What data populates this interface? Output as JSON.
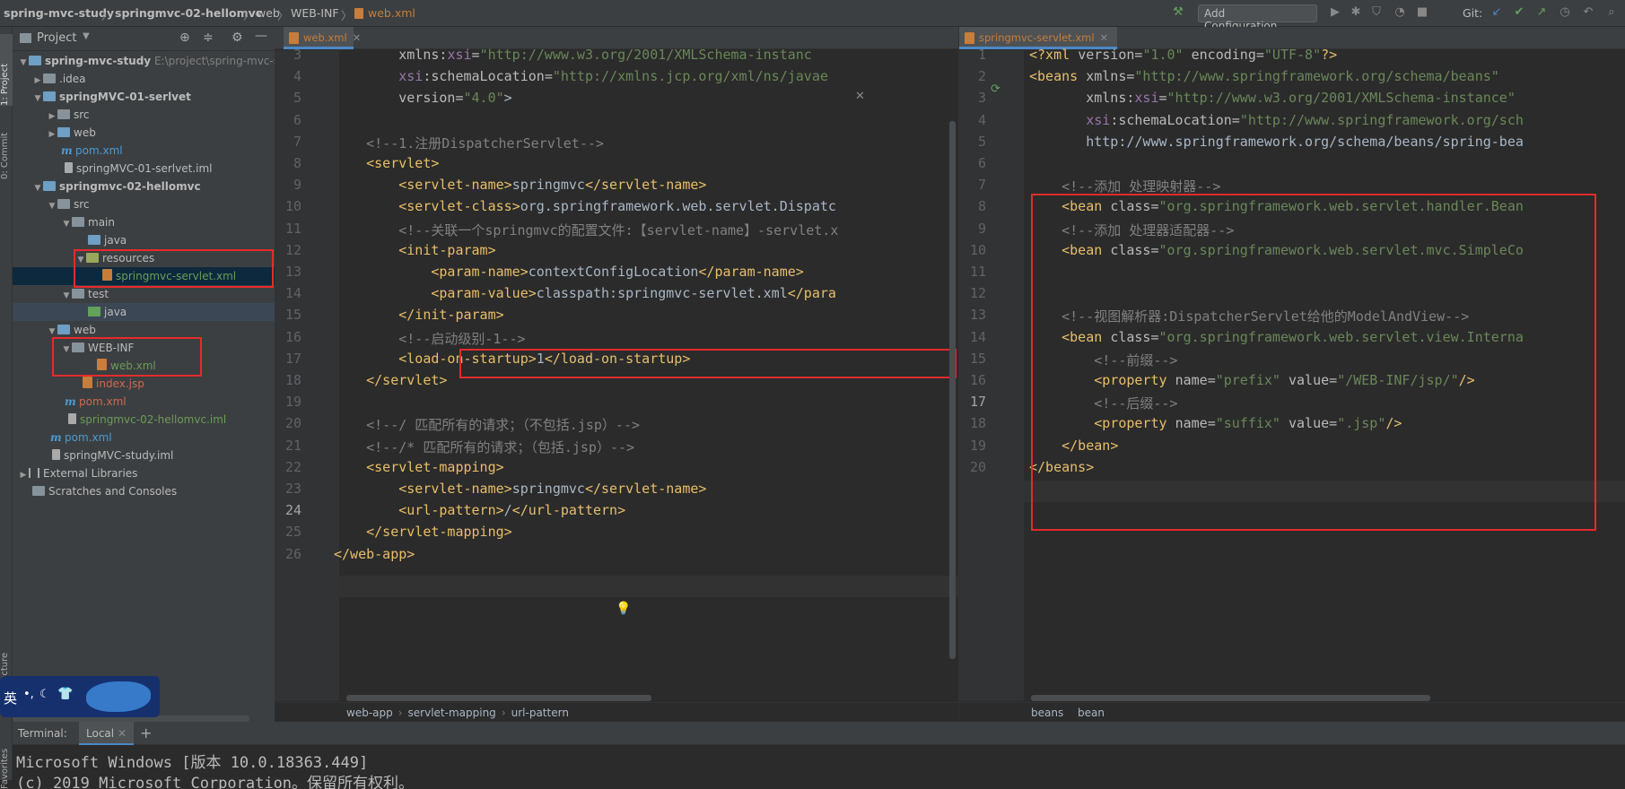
{
  "topbar": {
    "breadcrumbs": [
      "spring-mvc-study",
      "springmvc-02-hellomvc",
      "web",
      "WEB-INF",
      "web.xml"
    ],
    "add_configuration": "Add Configuration...",
    "git_label": "Git:"
  },
  "left_strip": {
    "project_label": "1: Project",
    "commit_label": "0: Commit",
    "structure_label": "ucture",
    "favorites_label": "Favorites"
  },
  "project_panel": {
    "title": "Project",
    "items": [
      {
        "label": "spring-mvc-study",
        "path": "E:\\project\\spring-mvc-s"
      },
      {
        "label": ".idea"
      },
      {
        "label": "springMVC-01-serlvet"
      },
      {
        "label": "src"
      },
      {
        "label": "web"
      },
      {
        "label": "pom.xml"
      },
      {
        "label": "springMVC-01-serlvet.iml"
      },
      {
        "label": "springmvc-02-hellomvc"
      },
      {
        "label": "src"
      },
      {
        "label": "main"
      },
      {
        "label": "java"
      },
      {
        "label": "resources"
      },
      {
        "label": "springmvc-servlet.xml"
      },
      {
        "label": "test"
      },
      {
        "label": "java"
      },
      {
        "label": "web"
      },
      {
        "label": "WEB-INF"
      },
      {
        "label": "web.xml"
      },
      {
        "label": "index.jsp"
      },
      {
        "label": "pom.xml"
      },
      {
        "label": "springmvc-02-hellomvc.iml"
      },
      {
        "label": "pom.xml"
      },
      {
        "label": "springMVC-study.iml"
      },
      {
        "label": "External Libraries"
      },
      {
        "label": "Scratches and Consoles"
      }
    ]
  },
  "editor_left": {
    "tab": "web.xml",
    "line_numbers": [
      "3",
      "4",
      "5",
      "6",
      "7",
      "8",
      "9",
      "10",
      "11",
      "12",
      "13",
      "14",
      "15",
      "16",
      "17",
      "18",
      "19",
      "20",
      "21",
      "22",
      "23",
      "24",
      "25",
      "26"
    ],
    "lines": [
      "        xmlns:xsi=\"http://www.w3.org/2001/XMLSchema-instanc",
      "        xsi:schemaLocation=\"http://xmlns.jcp.org/xml/ns/javae",
      "        version=\"4.0\">",
      "",
      "    <!--1.注册DispatcherServlet-->",
      "    <servlet>",
      "        <servlet-name>springmvc</servlet-name>",
      "        <servlet-class>org.springframework.web.servlet.Dispatc",
      "        <!--关联一个springmvc的配置文件:【servlet-name】-servlet.x",
      "        <init-param>",
      "            <param-name>contextConfigLocation</param-name>",
      "            <param-value>classpath:springmvc-servlet.xml</para",
      "        </init-param>",
      "        <!--启动级别-1-->",
      "        <load-on-startup>1</load-on-startup>",
      "    </servlet>",
      "",
      "    <!--/ 匹配所有的请求；（不包括.jsp）-->",
      "    <!--/* 匹配所有的请求；（包括.jsp）-->",
      "    <servlet-mapping>",
      "        <servlet-name>springmvc</servlet-name>",
      "        <url-pattern>/</url-pattern>",
      "    </servlet-mapping>",
      "</web-app>"
    ],
    "breadcrumb": [
      "web-app",
      "servlet-mapping",
      "url-pattern"
    ]
  },
  "editor_right": {
    "tab": "springmvc-servlet.xml",
    "line_numbers": [
      "1",
      "2",
      "3",
      "4",
      "5",
      "6",
      "7",
      "8",
      "9",
      "10",
      "11",
      "12",
      "13",
      "14",
      "15",
      "16",
      "17",
      "18",
      "19",
      "20"
    ],
    "lines": [
      "<?xml version=\"1.0\" encoding=\"UTF-8\"?>",
      "<beans xmlns=\"http://www.springframework.org/schema/beans\"",
      "       xmlns:xsi=\"http://www.w3.org/2001/XMLSchema-instance\"",
      "       xsi:schemaLocation=\"http://www.springframework.org/sch",
      "       http://www.springframework.org/schema/beans/spring-bea",
      "",
      "    <!--添加 处理映射器-->",
      "    <bean class=\"org.springframework.web.servlet.handler.Bean",
      "    <!--添加 处理器适配器-->",
      "    <bean class=\"org.springframework.web.servlet.mvc.SimpleCo",
      "",
      "",
      "    <!--视图解析器:DispatcherServlet给他的ModelAndView-->",
      "    <bean class=\"org.springframework.web.servlet.view.Interna",
      "        <!--前缀-->",
      "        <property name=\"prefix\" value=\"/WEB-INF/jsp/\"/>",
      "        <!--后缀-->",
      "        <property name=\"suffix\" value=\".jsp\"/>",
      "    </bean>",
      "</beans>"
    ],
    "breadcrumb": [
      "beans",
      "bean"
    ]
  },
  "terminal": {
    "label": "Terminal:",
    "tab": "Local",
    "lines": [
      "Microsoft Windows [版本 10.0.18363.449]",
      "(c) 2019 Microsoft Corporation。保留所有权利。"
    ]
  },
  "ime": {
    "label": "英"
  },
  "colors": {
    "highlight_box": "#e52b2b",
    "background": "#2b2b2b",
    "panel": "#3c3f41"
  }
}
